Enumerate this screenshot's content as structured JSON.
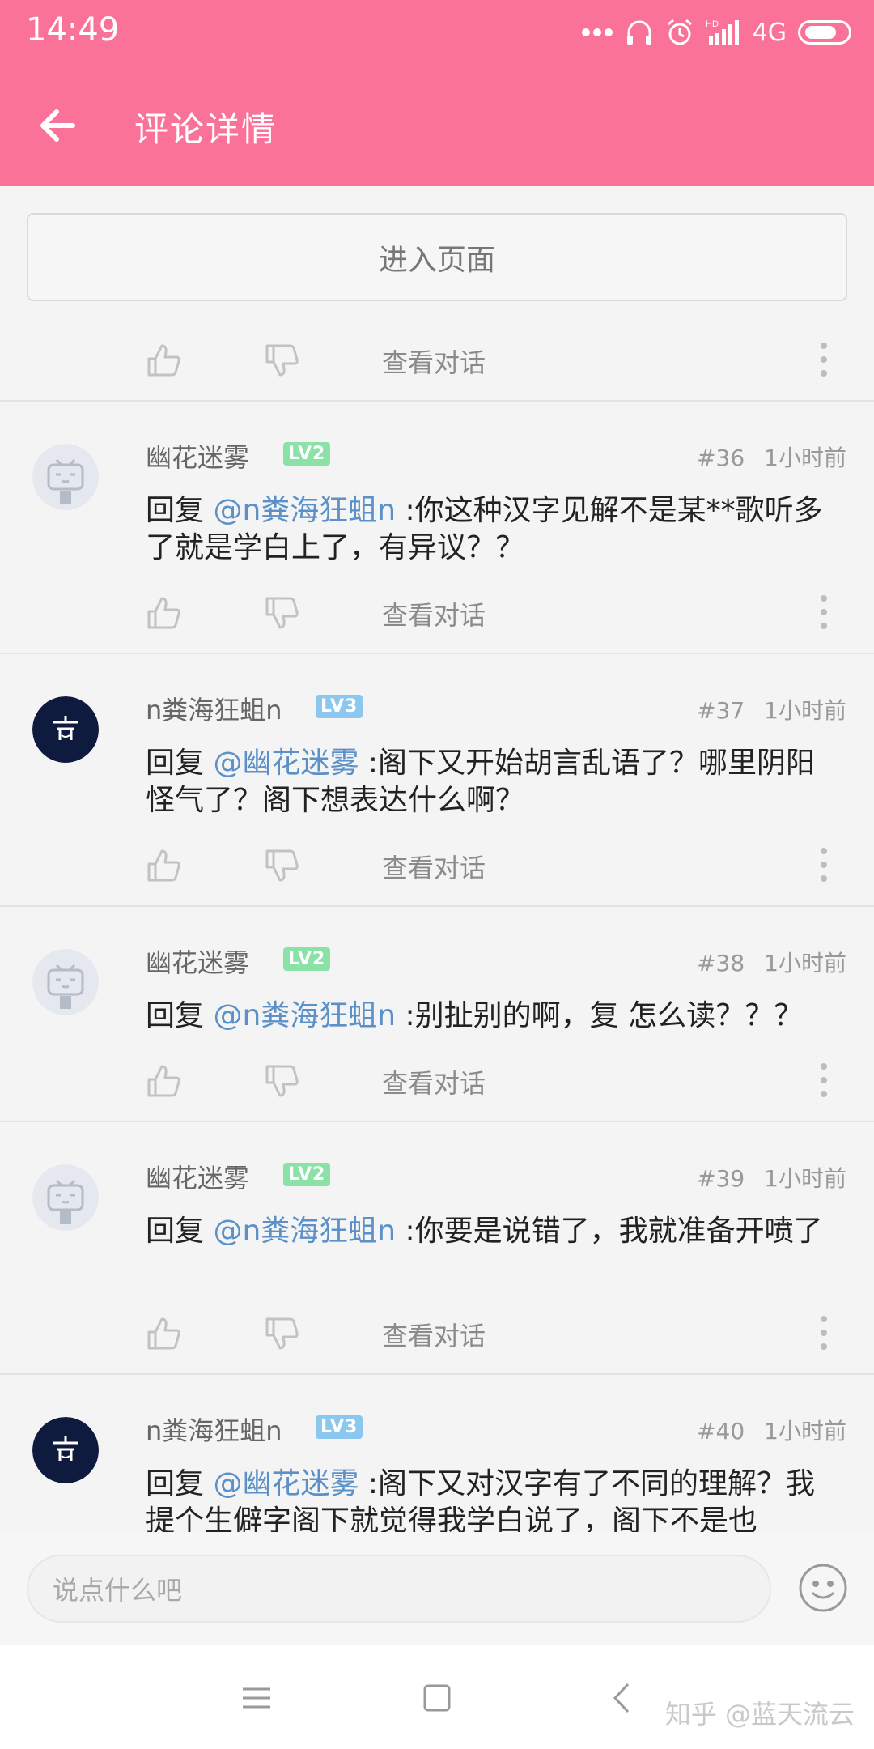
{
  "status_bar": {
    "time": "14:49",
    "network": "4G"
  },
  "header": {
    "title": "评论详情"
  },
  "enter_page_label": "进入页面",
  "view_dialog_label": "查看对话",
  "comments": [
    {
      "username": "幽花迷雾",
      "level": "LV2",
      "floor": "#36",
      "time": "1小时前",
      "reply_prefix": "回复 ",
      "mention": "@n粪海狂蛆n",
      "body": " :你这种汉字见解不是某**歌听多了就是学白上了，有异议？？"
    },
    {
      "username": "n粪海狂蛆n",
      "level": "LV3",
      "floor": "#37",
      "time": "1小时前",
      "reply_prefix": "回复 ",
      "mention": "@幽花迷雾",
      "body": " :阁下又开始胡言乱语了？哪里阴阳怪气了？阁下想表达什么啊？"
    },
    {
      "username": "幽花迷雾",
      "level": "LV2",
      "floor": "#38",
      "time": "1小时前",
      "reply_prefix": "回复 ",
      "mention": "@n粪海狂蛆n",
      "body": " :别扯别的啊，复 怎么读？？？"
    },
    {
      "username": "幽花迷雾",
      "level": "LV2",
      "floor": "#39",
      "time": "1小时前",
      "reply_prefix": "回复 ",
      "mention": "@n粪海狂蛆n",
      "body": " :你要是说错了，我就准备开喷了"
    },
    {
      "username": "n粪海狂蛆n",
      "level": "LV3",
      "floor": "#40",
      "time": "1小时前",
      "reply_prefix": "回复 ",
      "mention": "@幽花迷雾",
      "body": " :阁下又对汉字有了不同的理解？我提个生僻字阁下就觉得我学白说了，阁下不是也"
    }
  ],
  "input": {
    "placeholder": "说点什么吧"
  },
  "watermark": "知乎 @蓝天流云",
  "colors": {
    "brand_pink": "#fb7299",
    "mention_blue": "#5b91c8",
    "lv2_green": "#8be2a6",
    "lv3_blue": "#8cc7ef"
  }
}
